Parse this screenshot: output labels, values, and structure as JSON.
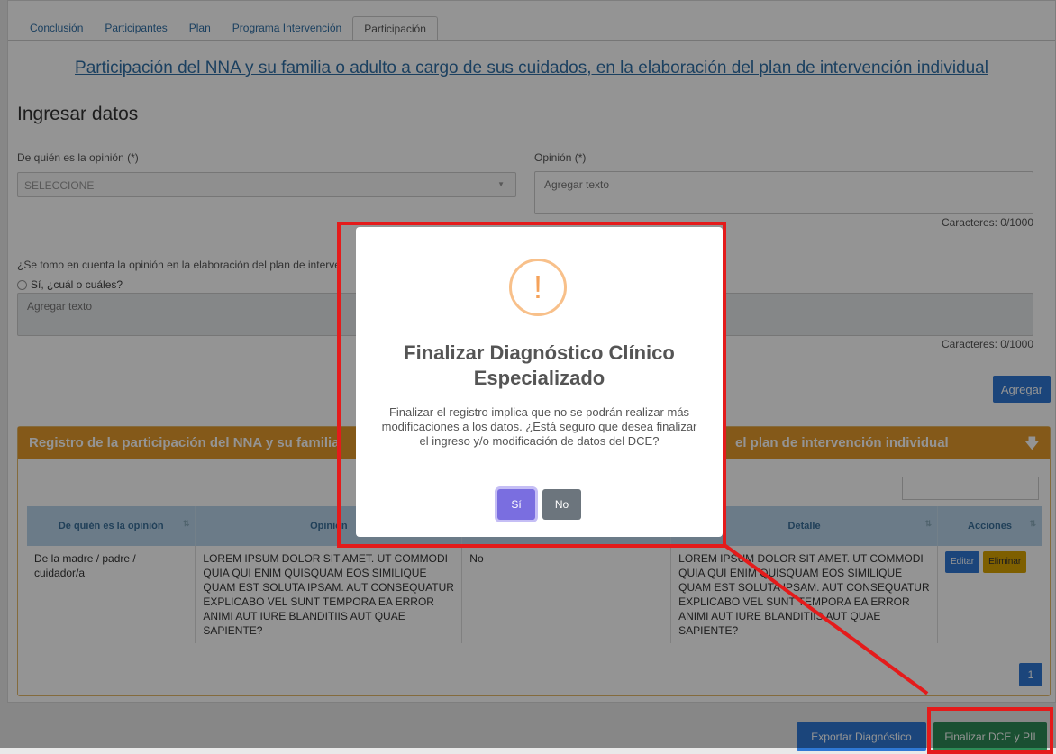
{
  "tabs": [
    "Conclusión",
    "Participantes",
    "Plan",
    "Programa Intervención",
    "Participación"
  ],
  "page_title": "Participación del NNA y su familia o adulto a cargo de sus cuidados, en la elaboración del plan de intervención individual",
  "section_title": "Ingresar datos",
  "form": {
    "opinion_source_label": "De quién es la opinión (*)",
    "opinion_source_value": "SELECCIONE",
    "opinion_label": "Opinión (*)",
    "opinion_placeholder": "Agregar texto",
    "opinion_counter": "Caracteres: 0/1000",
    "considered_question": "¿Se tomo en cuenta la opinión en la elaboración del plan de interve",
    "yes_option": "Sí, ¿cuál o cuáles?",
    "yes_placeholder": "Agregar texto",
    "yes_counter": "Caracteres: 0/1000",
    "add_button": "Agregar"
  },
  "panel": {
    "title_left": "Registro de la participación del NNA y su fam",
    "title_mid": "ilia",
    "title_right": "el plan de intervención individual",
    "columns": [
      "De quién es la opinión",
      "Opinión",
      "",
      "Detalle",
      "Acciones"
    ],
    "row": {
      "who": "De la madre / padre / cuidador/a",
      "opinion": "LOREM IPSUM DOLOR SIT AMET. UT COMMODI QUIA QUI ENIM QUISQUAM EOS SIMILIQUE QUAM EST SOLUTA IPSAM. AUT CONSEQUATUR EXPLICABO VEL SUNT TEMPORA EA ERROR ANIMI AUT IURE BLANDITIIS AUT QUAE SAPIENTE?",
      "considered": "No",
      "detail": "LOREM IPSUM DOLOR SIT AMET. UT COMMODI QUIA QUI ENIM QUISQUAM EOS SIMILIQUE QUAM EST SOLUTA IPSAM. AUT CONSEQUATUR EXPLICABO VEL SUNT TEMPORA EA ERROR ANIMI AUT IURE BLANDITIIS AUT QUAE SAPIENTE?",
      "edit": "Editar",
      "delete": "Eliminar"
    },
    "page": "1"
  },
  "footer": {
    "export_button": "Exportar Diagnóstico",
    "finish_button": "Finalizar DCE y PII"
  },
  "modal": {
    "icon": "!",
    "title": "Finalizar Diagnóstico Clínico Especializado",
    "text": "Finalizar el registro implica que no se podrán realizar más modificaciones a los datos. ¿Está seguro que desea finalizar el ingreso y/o modificación de datos del DCE?",
    "yes": "Sí",
    "no": "No"
  },
  "colors": {
    "accent": "#2f78d4",
    "panel_header": "#e39a2c",
    "highlight": "#e41b1b",
    "modal_yes": "#7a6ee0",
    "modal_no": "#6c757d"
  }
}
